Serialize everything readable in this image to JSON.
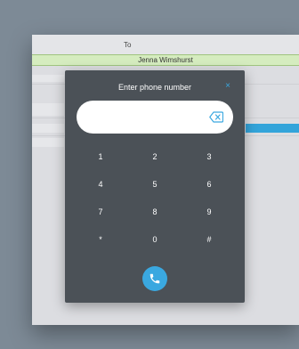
{
  "background": {
    "to_label": "To",
    "recipient_name": "Jenna Wimshurst"
  },
  "dialog": {
    "title": "Enter phone number",
    "close_glyph": "×",
    "phone_value": "",
    "keypad": [
      [
        "1",
        "2",
        "3"
      ],
      [
        "4",
        "5",
        "6"
      ],
      [
        "7",
        "8",
        "9"
      ],
      [
        "*",
        "0",
        "#"
      ]
    ],
    "icons": {
      "close": "close-icon",
      "backspace": "backspace-icon",
      "call": "phone-icon"
    }
  },
  "colors": {
    "accent": "#3aa8e0",
    "dialog_bg": "#4b5157",
    "recipient_bg": "#d5ecbf"
  }
}
